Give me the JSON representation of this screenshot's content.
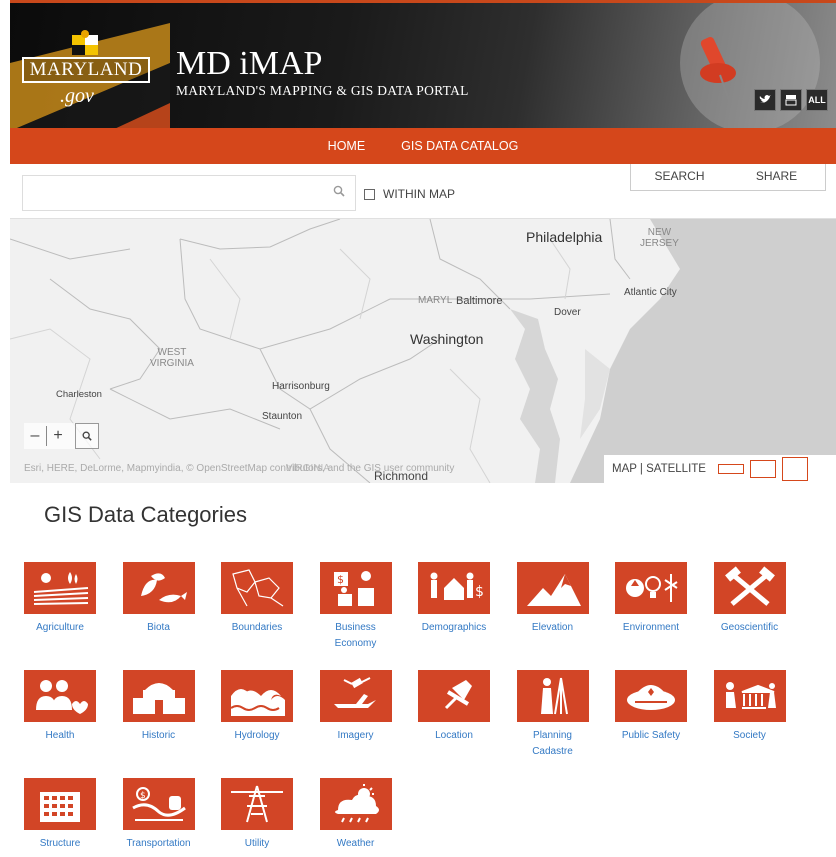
{
  "header": {
    "logo_text": "MARYLAND",
    "logo_suffix": ".gov",
    "title": "MD iMAP",
    "subtitle": "MARYLAND'S MAPPING & GIS DATA PORTAL",
    "social": [
      {
        "icon": "twitter-icon",
        "glyph": "🐦"
      },
      {
        "icon": "youtube-icon",
        "glyph": "You"
      },
      {
        "icon": "all-icon",
        "glyph": "ALL"
      }
    ]
  },
  "nav": {
    "items": [
      "HOME",
      "GIS DATA CATALOG"
    ]
  },
  "search": {
    "placeholder": "",
    "within_map_label": "WITHIN MAP",
    "tabs": [
      "SEARCH",
      "SHARE"
    ]
  },
  "map": {
    "labels": {
      "philadelphia": "Philadelphia",
      "new_jersey": "NEW\nJERSEY",
      "atlantic_city": "Atlantic City",
      "maryland": "MARYL",
      "baltimore": "Baltimore",
      "dover": "Dover",
      "washington": "Washington",
      "west_virginia": "WEST\nVIRGINIA",
      "charleston": "Charleston",
      "harrisonburg": "Harrisonburg",
      "staunton": "Staunton",
      "richmond": "Richmond",
      "virginia": "VIRGINIA"
    },
    "attribution": "Esri, HERE, DeLorme, Mapmyindia, © OpenStreetMap contributors, and the GIS user community",
    "basemap_label": "MAP | SATELLITE",
    "zoom_out": "–",
    "zoom_in": "+",
    "search_icon": "🔍"
  },
  "categories": {
    "title": "GIS Data Categories",
    "accent": "#d24526",
    "link_color": "#3379c4",
    "items": [
      {
        "label": "Agriculture",
        "icon": "agriculture-icon"
      },
      {
        "label": "Biota",
        "icon": "biota-icon"
      },
      {
        "label": "Boundaries",
        "icon": "boundaries-icon"
      },
      {
        "label": "Business\nEconomy",
        "icon": "business-icon"
      },
      {
        "label": "Demographics",
        "icon": "demographics-icon"
      },
      {
        "label": "Elevation",
        "icon": "elevation-icon"
      },
      {
        "label": "Environment",
        "icon": "environment-icon"
      },
      {
        "label": "Geoscientific",
        "icon": "geoscientific-icon"
      },
      {
        "label": "Health",
        "icon": "health-icon"
      },
      {
        "label": "Historic",
        "icon": "historic-icon"
      },
      {
        "label": "Hydrology",
        "icon": "hydrology-icon"
      },
      {
        "label": "Imagery",
        "icon": "imagery-icon"
      },
      {
        "label": "Location",
        "icon": "location-icon"
      },
      {
        "label": "Planning\nCadastre",
        "icon": "planning-icon"
      },
      {
        "label": "Public Safety",
        "icon": "public-safety-icon"
      },
      {
        "label": "Society",
        "icon": "society-icon"
      },
      {
        "label": "Structure",
        "icon": "structure-icon"
      },
      {
        "label": "Transportation",
        "icon": "transportation-icon"
      },
      {
        "label": "Utility",
        "icon": "utility-icon"
      },
      {
        "label": "Weather",
        "icon": "weather-icon"
      }
    ]
  }
}
